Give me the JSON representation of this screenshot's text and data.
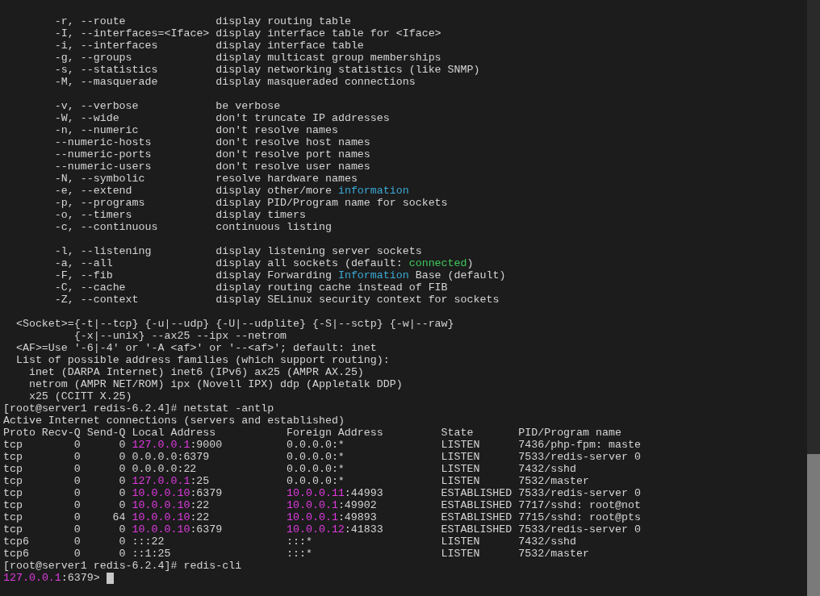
{
  "help_groups": [
    [
      {
        "option": "-r, --route",
        "description": [
          {
            "text": "display routing table"
          }
        ]
      },
      {
        "option": "-I, --interfaces=<Iface>",
        "description": [
          {
            "text": "display interface table for <Iface>"
          }
        ]
      },
      {
        "option": "-i, --interfaces",
        "description": [
          {
            "text": "display interface table"
          }
        ]
      },
      {
        "option": "-g, --groups",
        "description": [
          {
            "text": "display multicast group memberships"
          }
        ]
      },
      {
        "option": "-s, --statistics",
        "description": [
          {
            "text": "display networking statistics (like SNMP)"
          }
        ]
      },
      {
        "option": "-M, --masquerade",
        "description": [
          {
            "text": "display masqueraded connections"
          }
        ]
      }
    ],
    [
      {
        "option": "-v, --verbose",
        "description": [
          {
            "text": "be verbose"
          }
        ]
      },
      {
        "option": "-W, --wide",
        "description": [
          {
            "text": "don't truncate IP addresses"
          }
        ]
      },
      {
        "option": "-n, --numeric",
        "description": [
          {
            "text": "don't resolve names"
          }
        ]
      },
      {
        "option": "--numeric-hosts",
        "description": [
          {
            "text": "don't resolve host names"
          }
        ]
      },
      {
        "option": "--numeric-ports",
        "description": [
          {
            "text": "don't resolve port names"
          }
        ]
      },
      {
        "option": "--numeric-users",
        "description": [
          {
            "text": "don't resolve user names"
          }
        ]
      },
      {
        "option": "-N, --symbolic",
        "description": [
          {
            "text": "resolve hardware names"
          }
        ]
      },
      {
        "option": "-e, --extend",
        "description": [
          {
            "text": "display other/more "
          },
          {
            "text": "information",
            "color": "#3aa9d6"
          }
        ]
      },
      {
        "option": "-p, --programs",
        "description": [
          {
            "text": "display PID/Program name for sockets"
          }
        ]
      },
      {
        "option": "-o, --timers",
        "description": [
          {
            "text": "display timers"
          }
        ]
      },
      {
        "option": "-c, --continuous",
        "description": [
          {
            "text": "continuous listing"
          }
        ]
      }
    ],
    [
      {
        "option": "-l, --listening",
        "description": [
          {
            "text": "display listening server sockets"
          }
        ]
      },
      {
        "option": "-a, --all",
        "description": [
          {
            "text": "display all sockets (default: "
          },
          {
            "text": "connected",
            "color": "#3dc95a"
          },
          {
            "text": ")"
          }
        ]
      },
      {
        "option": "-F, --fib",
        "description": [
          {
            "text": "display Forwarding "
          },
          {
            "text": "Information",
            "color": "#3aa9d6"
          },
          {
            "text": " Base (default)"
          }
        ]
      },
      {
        "option": "-C, --cache",
        "description": [
          {
            "text": "display routing cache instead of FIB"
          }
        ]
      },
      {
        "option": "-Z, --context",
        "description": [
          {
            "text": "display SELinux security context for sockets"
          }
        ]
      }
    ]
  ],
  "usage_lines": [
    {
      "kind": "usage",
      "text": "<Socket>={-t|--tcp} {-u|--udp} {-U|--udplite} {-S|--sctp} {-w|--raw}"
    },
    {
      "kind": "continuation",
      "text": "{-x|--unix} --ax25 --ipx --netrom"
    },
    {
      "kind": "usage",
      "text": "<AF>=Use '-6|-4' or '-A <af>' or '--<af>'; default: inet"
    },
    {
      "kind": "usage",
      "text": "List of possible address families (which support routing):"
    },
    {
      "kind": "family",
      "text": "inet (DARPA Internet) inet6 (IPv6) ax25 (AMPR AX.25)"
    },
    {
      "kind": "family",
      "text": "netrom (AMPR NET/ROM) ipx (Novell IPX) ddp (Appletalk DDP)"
    },
    {
      "kind": "family",
      "text": "x25 (CCITT X.25)"
    }
  ],
  "netstat_command": "[root@server1 redis-6.2.4]# netstat -antlp",
  "netstat": {
    "title": "Active Internet connections (servers and established)",
    "columns": [
      "Proto",
      "Recv-Q",
      "Send-Q",
      "Local Address",
      "Foreign Address",
      "State",
      "PID/Program name"
    ],
    "rows": [
      {
        "proto": "tcp",
        "recv_q": "0",
        "send_q": "0",
        "local": {
          "host": "127.0.0.1",
          "port": ":9000",
          "highlight": true
        },
        "foreign": {
          "host": "0.0.0.0",
          "port": ":*",
          "highlight": false
        },
        "state": "LISTEN",
        "program": "7436/php-fpm: maste"
      },
      {
        "proto": "tcp",
        "recv_q": "0",
        "send_q": "0",
        "local": {
          "host": "0.0.0.0",
          "port": ":6379",
          "highlight": false
        },
        "foreign": {
          "host": "0.0.0.0",
          "port": ":*",
          "highlight": false
        },
        "state": "LISTEN",
        "program": "7533/redis-server 0"
      },
      {
        "proto": "tcp",
        "recv_q": "0",
        "send_q": "0",
        "local": {
          "host": "0.0.0.0",
          "port": ":22",
          "highlight": false
        },
        "foreign": {
          "host": "0.0.0.0",
          "port": ":*",
          "highlight": false
        },
        "state": "LISTEN",
        "program": "7432/sshd"
      },
      {
        "proto": "tcp",
        "recv_q": "0",
        "send_q": "0",
        "local": {
          "host": "127.0.0.1",
          "port": ":25",
          "highlight": true
        },
        "foreign": {
          "host": "0.0.0.0",
          "port": ":*",
          "highlight": false
        },
        "state": "LISTEN",
        "program": "7532/master"
      },
      {
        "proto": "tcp",
        "recv_q": "0",
        "send_q": "0",
        "local": {
          "host": "10.0.0.10",
          "port": ":6379",
          "highlight": true
        },
        "foreign": {
          "host": "10.0.0.11",
          "port": ":44993",
          "highlight": true
        },
        "state": "ESTABLISHED",
        "program": "7533/redis-server 0"
      },
      {
        "proto": "tcp",
        "recv_q": "0",
        "send_q": "0",
        "local": {
          "host": "10.0.0.10",
          "port": ":22",
          "highlight": true
        },
        "foreign": {
          "host": "10.0.0.1",
          "port": ":49902",
          "highlight": true
        },
        "state": "ESTABLISHED",
        "program": "7717/sshd: root@not"
      },
      {
        "proto": "tcp",
        "recv_q": "0",
        "send_q": "64",
        "local": {
          "host": "10.0.0.10",
          "port": ":22",
          "highlight": true
        },
        "foreign": {
          "host": "10.0.0.1",
          "port": ":49893",
          "highlight": true
        },
        "state": "ESTABLISHED",
        "program": "7715/sshd: root@pts"
      },
      {
        "proto": "tcp",
        "recv_q": "0",
        "send_q": "0",
        "local": {
          "host": "10.0.0.10",
          "port": ":6379",
          "highlight": true
        },
        "foreign": {
          "host": "10.0.0.12",
          "port": ":41833",
          "highlight": true
        },
        "state": "ESTABLISHED",
        "program": "7533/redis-server 0"
      },
      {
        "proto": "tcp6",
        "recv_q": "0",
        "send_q": "0",
        "local": {
          "host": "::",
          "port": ":22",
          "highlight": false
        },
        "foreign": {
          "host": "::",
          "port": ":*",
          "highlight": false
        },
        "state": "LISTEN",
        "program": "7432/sshd"
      },
      {
        "proto": "tcp6",
        "recv_q": "0",
        "send_q": "0",
        "local": {
          "host": "::1",
          "port": ":25",
          "highlight": false
        },
        "foreign": {
          "host": "::",
          "port": ":*",
          "highlight": false
        },
        "state": "LISTEN",
        "program": "7532/master"
      }
    ]
  },
  "redis_command": "[root@server1 redis-6.2.4]# redis-cli",
  "redis_prompt": {
    "host": "127.0.0.1",
    "rest": ":6379>"
  }
}
